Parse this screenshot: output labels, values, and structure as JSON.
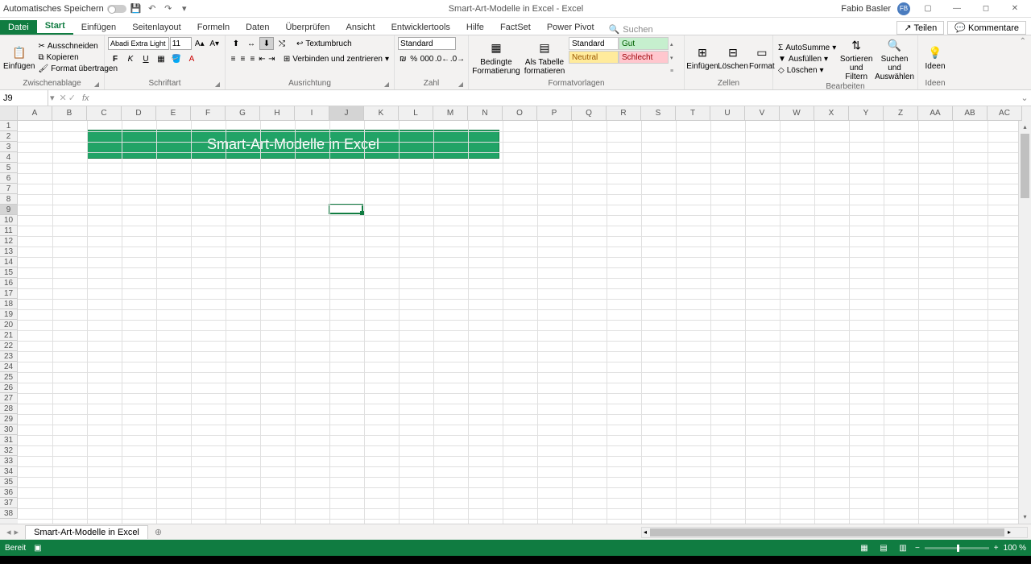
{
  "title": {
    "doc": "Smart-Art-Modelle in Excel",
    "sep": " - ",
    "app": "Excel"
  },
  "autosave_label": "Automatisches Speichern",
  "user_name": "Fabio Basler",
  "user_initials": "FB",
  "tabs": {
    "file": "Datei",
    "list": [
      "Start",
      "Einfügen",
      "Seitenlayout",
      "Formeln",
      "Daten",
      "Überprüfen",
      "Ansicht",
      "Entwicklertools",
      "Hilfe",
      "FactSet",
      "Power Pivot"
    ],
    "active": "Start",
    "search_placeholder": "Suchen",
    "share": "Teilen",
    "comments": "Kommentare"
  },
  "ribbon": {
    "clipboard": {
      "paste": "Einfügen",
      "cut": "Ausschneiden",
      "copy": "Kopieren",
      "format_painter": "Format übertragen",
      "label": "Zwischenablage"
    },
    "font": {
      "name": "Abadi Extra Light",
      "size": "11",
      "label": "Schriftart"
    },
    "align": {
      "wrap": "Textumbruch",
      "merge": "Verbinden und zentrieren",
      "label": "Ausrichtung"
    },
    "number": {
      "format": "Standard",
      "label": "Zahl"
    },
    "styles": {
      "cond": "Bedingte Formatierung",
      "table": "Als Tabelle formatieren",
      "s1": "Standard",
      "s2": "Gut",
      "s3": "Neutral",
      "s4": "Schlecht",
      "label": "Formatvorlagen"
    },
    "cells": {
      "insert": "Einfügen",
      "delete": "Löschen",
      "format": "Format",
      "label": "Zellen"
    },
    "editing": {
      "sum": "AutoSumme",
      "fill": "Ausfüllen",
      "clear": "Löschen",
      "sort": "Sortieren und Filtern",
      "find": "Suchen und Auswählen",
      "label": "Bearbeiten"
    },
    "ideas": {
      "btn": "Ideen",
      "label": "Ideen"
    }
  },
  "namebox": "J9",
  "columns": [
    "A",
    "B",
    "C",
    "D",
    "E",
    "F",
    "G",
    "H",
    "I",
    "J",
    "K",
    "L",
    "M",
    "N",
    "O",
    "P",
    "Q",
    "R",
    "S",
    "T",
    "U",
    "V",
    "W",
    "X",
    "Y",
    "Z",
    "AA",
    "AB",
    "AC"
  ],
  "active_col": "J",
  "active_row": 9,
  "row_count": 38,
  "banner_text": "Smart-Art-Modelle in Excel",
  "sheet_tab": "Smart-Art-Modelle in Excel",
  "status": {
    "ready": "Bereit",
    "zoom": "100 %"
  }
}
